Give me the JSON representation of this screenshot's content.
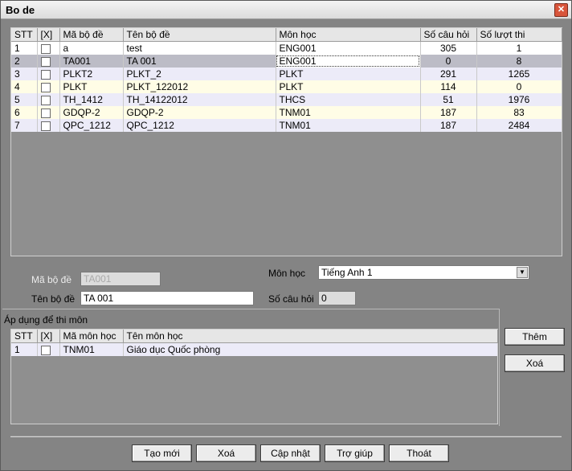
{
  "window": {
    "title": "Bo de",
    "close_glyph": "✕"
  },
  "main_grid": {
    "columns": [
      "STT",
      "[X]",
      "Mã bộ đề",
      "Tên bộ đề",
      "Môn học",
      "Số câu hỏi",
      "Số lượt thi"
    ],
    "rows": [
      {
        "stt": "1",
        "code": "a",
        "name": "test",
        "subject": "ENG001",
        "questions": "305",
        "attempts": "1",
        "style": "white"
      },
      {
        "stt": "2",
        "code": "TA001",
        "name": "TA 001",
        "subject": "ENG001",
        "questions": "0",
        "attempts": "8",
        "style": "sel"
      },
      {
        "stt": "3",
        "code": "PLKT2",
        "name": "PLKT_2",
        "subject": "PLKT",
        "questions": "291",
        "attempts": "1265",
        "style": "lav"
      },
      {
        "stt": "4",
        "code": "PLKT",
        "name": "PLKT_122012",
        "subject": "PLKT",
        "questions": "114",
        "attempts": "0",
        "style": "cream"
      },
      {
        "stt": "5",
        "code": "TH_1412",
        "name": "TH_14122012",
        "subject": "THCS",
        "questions": "51",
        "attempts": "1976",
        "style": "lav"
      },
      {
        "stt": "6",
        "code": "GDQP-2",
        "name": "GDQP-2",
        "subject": "TNM01",
        "questions": "187",
        "attempts": "83",
        "style": "cream"
      },
      {
        "stt": "7",
        "code": "QPC_1212",
        "name": "QPC_1212",
        "subject": "TNM01",
        "questions": "187",
        "attempts": "2484",
        "style": "lav"
      }
    ]
  },
  "form": {
    "code_label": "Mã bộ đề",
    "code_value": "TA001",
    "name_label": "Tên bộ đề",
    "name_value": "TA 001",
    "subject_label": "Môn học",
    "subject_value": "Tiếng Anh 1",
    "count_label": "Số câu hỏi",
    "count_value": "0"
  },
  "apply_group": {
    "title": "Áp dụng để thi môn",
    "columns": [
      "STT",
      "[X]",
      "Mã môn học",
      "Tên môn học"
    ],
    "rows": [
      {
        "stt": "1",
        "code": "TNM01",
        "name": "Giáo dục Quốc phòng"
      }
    ],
    "add_label": "Thêm",
    "remove_label": "Xoá"
  },
  "footer": {
    "new_label": "Tạo mới",
    "delete_label": "Xoá",
    "update_label": "Cập nhật",
    "help_label": "Trợ giúp",
    "exit_label": "Thoát"
  },
  "icons": {
    "checkbox": "checkbox-icon",
    "dropdown": "chevron-down-icon",
    "close": "close-icon"
  }
}
